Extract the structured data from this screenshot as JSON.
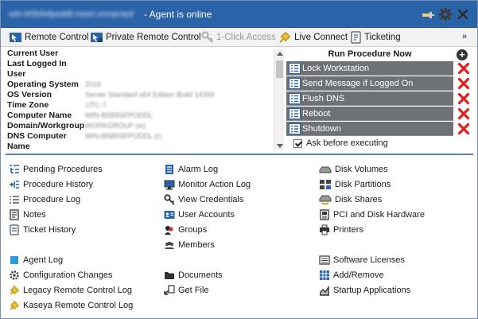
{
  "window": {
    "hostname": "win-b5b9sfpoddl.meet.unnamed",
    "status": "- Agent is online"
  },
  "toolbar": {
    "items": [
      {
        "label": "Remote Control",
        "icon": "remote-control-icon",
        "enabled": true
      },
      {
        "label": "Private Remote Control",
        "icon": "private-remote-control-icon",
        "enabled": true
      },
      {
        "label": "1-Click Access",
        "icon": "one-click-access-icon",
        "enabled": false
      },
      {
        "label": "Live Connect",
        "icon": "live-connect-icon",
        "enabled": true
      },
      {
        "label": "Ticketing",
        "icon": "ticketing-icon",
        "enabled": true
      }
    ],
    "more": "»"
  },
  "info": {
    "rows": [
      {
        "label": "Current User",
        "value": ""
      },
      {
        "label": "Last Logged In",
        "value": ""
      },
      {
        "label": "User",
        "value": ""
      },
      {
        "label": "Operating System",
        "value": "2016"
      },
      {
        "label": "OS Version",
        "value": "Server Standard x64 Edition Build 14393"
      },
      {
        "label": "Time Zone",
        "value": "UTC-7"
      },
      {
        "label": "Computer Name",
        "value": "WIN-B5B9SFPODDL"
      },
      {
        "label": "Domain/Workgroup",
        "value": "WORKGROUP (w)"
      },
      {
        "label": "DNS Computer",
        "value": "WIN-B5B9SFPODDL (r)"
      },
      {
        "label": "Name",
        "value": ""
      }
    ]
  },
  "procedures": {
    "header": "Run Procedure Now",
    "items": [
      "Lock Workstation",
      "Send Message if Logged On",
      "Flush DNS",
      "Reboot",
      "Shutdown"
    ],
    "ask_label": "Ask before executing",
    "ask_checked": true
  },
  "links": {
    "col1": [
      "Pending Procedures",
      "Procedure History",
      "Procedure Log",
      "Notes",
      "Ticket History",
      "Agent Log",
      "Configuration Changes",
      "Legacy Remote Control Log",
      "Kaseya Remote Control Log"
    ],
    "col2": [
      "Alarm Log",
      "Monitor Action Log",
      "View Credentials",
      "User Accounts",
      "Groups",
      "Members",
      "Documents",
      "Get File"
    ],
    "col3": [
      "Disk Volumes",
      "Disk Partitions",
      "Disk Shares",
      "PCI and Disk Hardware",
      "Printers",
      "Software Licenses",
      "Add/Remove",
      "Startup Applications"
    ]
  },
  "colors": {
    "titlebar": "#2a63a8",
    "procedure_button": "#6f7275",
    "delete_red": "#e02020",
    "accent": "#2a63a8"
  }
}
